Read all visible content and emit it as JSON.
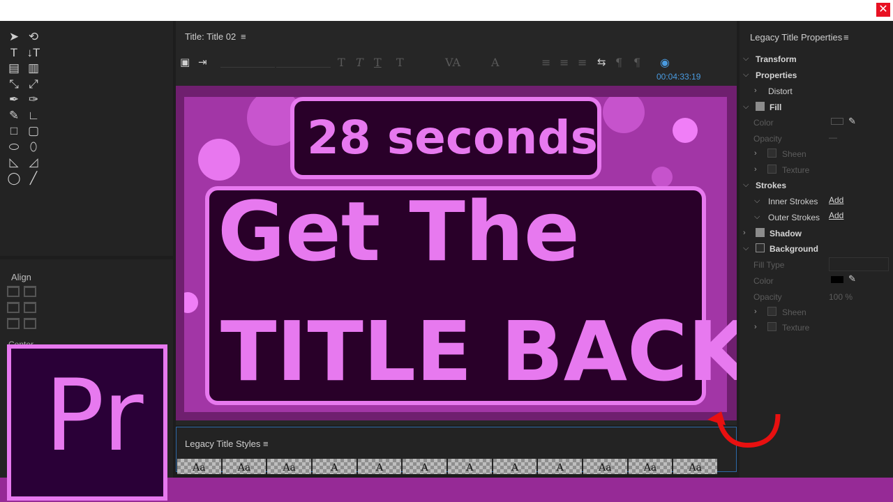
{
  "app": {
    "close_label": "✕"
  },
  "title_panel": {
    "tab_label": "Title: Title 02",
    "menu_glyph": "≡",
    "timecode": "00:04:33:19"
  },
  "overlay": {
    "badge_text": "28 seconds",
    "headline_line1": "Get The",
    "headline_line2": "TITLE BACK",
    "logo_text": "Pr",
    "accent_color": "#e779ef",
    "box_color": "#290029",
    "frame_color": "#a236a6",
    "bar_color": "#962a96"
  },
  "tools": {
    "icons": [
      "selection-icon",
      "rotate-icon",
      "type-icon",
      "vertical-type-icon",
      "area-type-icon",
      "vertical-area-type-icon",
      "path-type-icon",
      "vertical-path-type-icon",
      "pen-icon",
      "delete-anchor-icon",
      "add-anchor-icon",
      "convert-anchor-icon",
      "rectangle-icon",
      "rounded-rectangle-icon",
      "clipped-rectangle-icon",
      "rounded-corner-rectangle-icon",
      "wedge-icon",
      "arc-icon",
      "ellipse-icon",
      "line-icon"
    ],
    "glyphs": [
      "➤",
      "⟲",
      "T",
      "↓T",
      "▤",
      "▥",
      "⤡",
      "⤢",
      "✒",
      "✑",
      "✎",
      "∟",
      "□",
      "▢",
      "⬭",
      "⬯",
      "◺",
      "◿",
      "◯",
      "╱"
    ]
  },
  "align": {
    "label": "Align",
    "center_label": "Center"
  },
  "styles_panel": {
    "label": "Legacy Title Styles",
    "menu_glyph": "≡",
    "swatches": [
      "Aa",
      "Aa",
      "Aa",
      "A",
      "A",
      "A",
      "A",
      "A",
      "A",
      "Aa",
      "Aa",
      "Aa"
    ]
  },
  "properties": {
    "title": "Legacy Title Properties",
    "menu_glyph": "≡",
    "transform": "Transform",
    "properties": "Properties",
    "distort": "Distort",
    "fill": "Fill",
    "color": "Color",
    "opacity": "Opacity",
    "sheen": "Sheen",
    "texture": "Texture",
    "strokes": "Strokes",
    "inner_strokes": "Inner Strokes",
    "outer_strokes": "Outer Strokes",
    "add": "Add",
    "shadow": "Shadow",
    "background": "Background",
    "fill_type": "Fill Type",
    "bg_color": "Color",
    "bg_opacity": "Opacity",
    "bg_opacity_value": "100 %",
    "bg_sheen": "Sheen",
    "bg_texture": "Texture",
    "fill_opacity_value": "—"
  }
}
